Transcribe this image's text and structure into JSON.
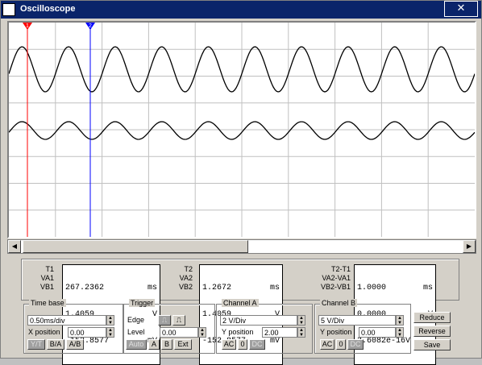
{
  "window": {
    "title": "Oscilloscope",
    "close_icon": "close-icon"
  },
  "screen": {
    "cursor1_label": "1",
    "cursor2_label": "2",
    "cursor1_color": "#ff0000",
    "cursor2_color": "#0000ff",
    "grid_color": "#c0c0c0"
  },
  "readout": {
    "t1": {
      "lbl_t": "T1",
      "lbl_va": "VA1",
      "lbl_vb": "VB1",
      "t": "267.2362",
      "t_unit": "ms",
      "va": "1.4059",
      "va_unit": "V",
      "vb": "-152.8577",
      "vb_unit": "mV"
    },
    "t2": {
      "lbl_t": "T2",
      "lbl_va": "VA2",
      "lbl_vb": "VB2",
      "t": "1.2672",
      "t_unit": "ms",
      "va": "1.4059",
      "va_unit": "V",
      "vb": "-152.8577",
      "vb_unit": "mV"
    },
    "diff": {
      "lbl_t": "T2-T1",
      "lbl_va": "VA2-VA1",
      "lbl_vb": "VB2-VB1",
      "t": "1.0000",
      "t_unit": "ms",
      "va": "0.0000",
      "va_unit": "V",
      "vb": "3.6082e-16V",
      "vb_unit": ""
    }
  },
  "timebase": {
    "title": "Time base",
    "value": "0.50ms/div",
    "xpos_label": "X position",
    "xpos": "0.00",
    "modes": [
      "Y/T",
      "B/A",
      "A/B"
    ]
  },
  "trigger": {
    "title": "Trigger",
    "edge_label": "Edge",
    "level_label": "Level",
    "level": "0.00",
    "rising_icon": "rising-edge-icon",
    "falling_icon": "falling-edge-icon",
    "sources": [
      "Auto",
      "A",
      "B",
      "Ext"
    ]
  },
  "channel_a": {
    "title": "Channel A",
    "value": "2 V/Div",
    "ypos_label": "Y position",
    "ypos": "2.00",
    "coupling": [
      "AC",
      "0",
      "DC"
    ]
  },
  "channel_b": {
    "title": "Channel B",
    "value": "5 V/Div",
    "ypos_label": "Y position",
    "ypos": "0.00",
    "coupling": [
      "AC",
      "0",
      "DC"
    ]
  },
  "buttons": {
    "reduce": "Reduce",
    "reverse": "Reverse",
    "save": "Save"
  }
}
